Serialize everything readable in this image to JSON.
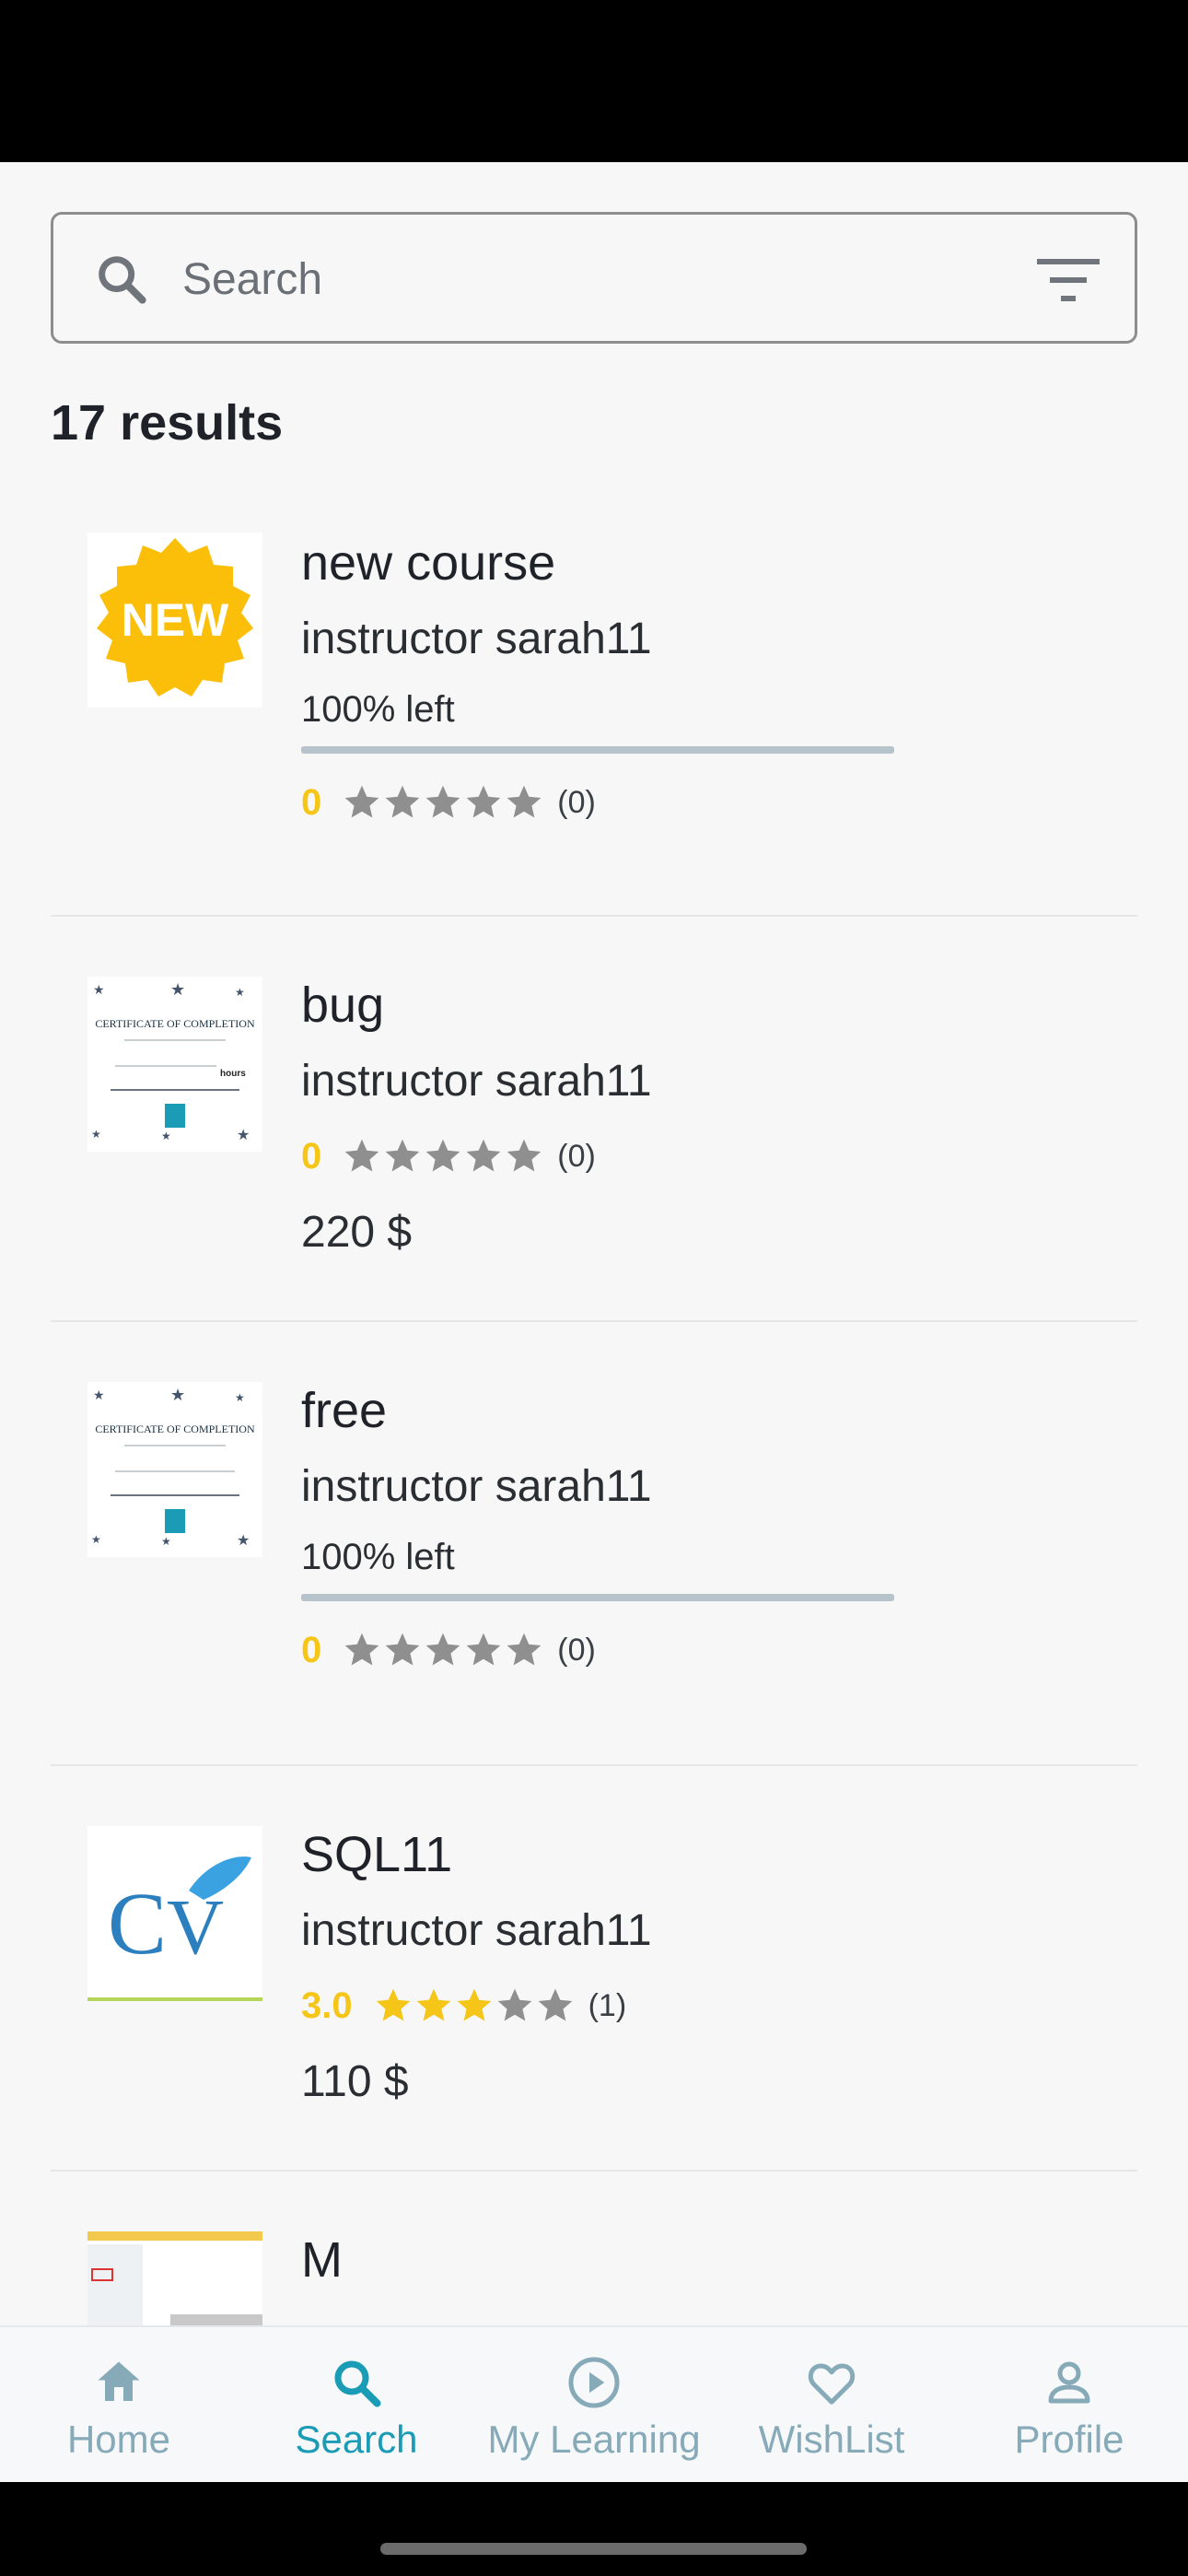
{
  "search": {
    "placeholder": "Search"
  },
  "results": {
    "count_label": "17 results"
  },
  "courses": [
    {
      "title": "new course",
      "instructor": "instructor sarah11",
      "progress_label": "100% left",
      "progress": 1.0,
      "rating_label": "0",
      "rating": 0,
      "rating_count": "(0)",
      "thumbnail": "new-badge",
      "badge_text": "NEW"
    },
    {
      "title": "bug",
      "instructor": "instructor sarah11",
      "rating_label": "0",
      "rating": 0,
      "rating_count": "(0)",
      "price": "220 $",
      "thumbnail": "certificate",
      "cert_title": "CERTIFICATE OF COMPLETION",
      "cert_hours": "hours"
    },
    {
      "title": "free",
      "instructor": "instructor sarah11",
      "progress_label": "100% left",
      "progress": 1.0,
      "rating_label": "0",
      "rating": 0,
      "rating_count": "(0)",
      "thumbnail": "certificate",
      "cert_title": "CERTIFICATE OF COMPLETION"
    },
    {
      "title": "SQL11",
      "instructor": "instructor sarah11",
      "rating_label": "3.0",
      "rating": 3,
      "rating_count": "(1)",
      "price": "110 $",
      "thumbnail": "cv-logo"
    },
    {
      "title": "M",
      "thumbnail": "screenshot"
    }
  ],
  "tabs": [
    {
      "label": "Home",
      "icon": "home-icon",
      "active": false
    },
    {
      "label": "Search",
      "icon": "search-icon",
      "active": true
    },
    {
      "label": "My Learning",
      "icon": "play-circle-icon",
      "active": false
    },
    {
      "label": "WishList",
      "icon": "heart-icon",
      "active": false
    },
    {
      "label": "Profile",
      "icon": "person-icon",
      "active": false
    }
  ],
  "colors": {
    "accent": "#1a9bb6",
    "tab_inactive": "#87aab9",
    "star_filled": "#f5c518",
    "star_empty": "#8f8f8f",
    "badge": "#fbbf0a"
  }
}
